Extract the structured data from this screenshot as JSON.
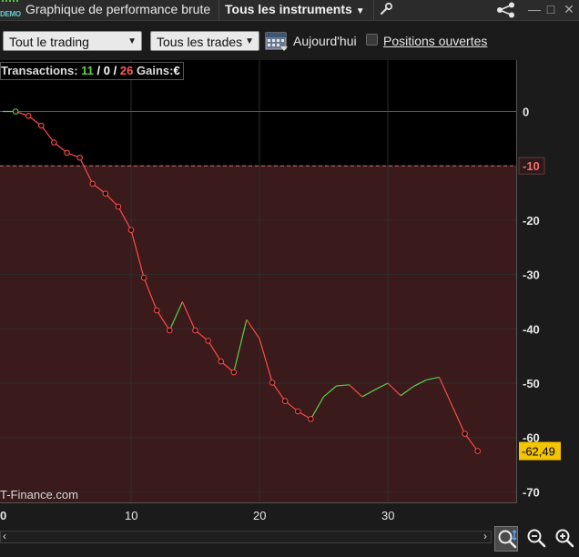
{
  "window": {
    "badge": "DEMO",
    "title": "Graphique de performance brute",
    "instruments_label": "Tous les instruments"
  },
  "toolbar": {
    "trading_select": "Tout le trading",
    "trades_select": "Tous les trades",
    "today_label": "Aujourd'hui",
    "open_positions_label": "Positions ouvertes",
    "open_positions_checked": false
  },
  "stats": {
    "label": "Transactions:",
    "wins": "11",
    "sep1": "/",
    "neutral": "0",
    "sep2": "/",
    "losses": "26",
    "gains_label": "Gains:",
    "currency": "€"
  },
  "watermark": "T-Finance.com",
  "colors": {
    "up": "#5ccf4c",
    "down": "#ff4a4a",
    "zero_line": "#3a4fd0",
    "loss_zone": "#3a1a1a",
    "last_value_bg": "#f4c400"
  },
  "chart_data": {
    "type": "line",
    "xlim": [
      0,
      40
    ],
    "ylim": [
      -72,
      9
    ],
    "x_ticks": [
      0,
      10,
      20,
      30
    ],
    "x_tick_labels": [
      "0",
      "10",
      "20",
      "30"
    ],
    "y_ticks": [
      0,
      -10,
      -20,
      -30,
      -40,
      -50,
      -60,
      -70
    ],
    "y_tick_labels": [
      "0",
      "-10",
      "-20",
      "-30",
      "-40",
      "-50",
      "-60",
      "-70"
    ],
    "drawdown_level": -10,
    "drawdown_label": "-10",
    "last_value": -62.49,
    "last_value_label": "-62,49",
    "grid": true,
    "x": [
      0,
      1,
      2,
      3,
      4,
      5,
      6,
      7,
      8,
      9,
      10,
      11,
      12,
      13,
      14,
      15,
      16,
      17,
      18,
      19,
      20,
      21,
      22,
      23,
      24,
      25,
      26,
      27,
      28,
      29,
      30,
      31,
      32,
      33,
      34,
      35,
      36,
      37
    ],
    "values": [
      0,
      0,
      -0.8,
      -2.6,
      -5.7,
      -7.6,
      -8.5,
      -13.3,
      -15.1,
      -17.5,
      -21.8,
      -30.6,
      -36.6,
      -40.3,
      -35.0,
      -40.3,
      -42.2,
      -46.0,
      -48.0,
      -38.3,
      -41.8,
      -49.9,
      -53.3,
      -55.2,
      -56.6,
      -52.5,
      -50.5,
      -50.3,
      -52.5,
      -51.2,
      -50.0,
      -52.3,
      -50.6,
      -49.4,
      -48.9,
      -54.1,
      -59.3,
      -62.49
    ],
    "markers": [
      1,
      2,
      3,
      4,
      5,
      6,
      7,
      8,
      9,
      10,
      11,
      12,
      13,
      15,
      16,
      17,
      18,
      21,
      22,
      23,
      24,
      36,
      37
    ]
  }
}
